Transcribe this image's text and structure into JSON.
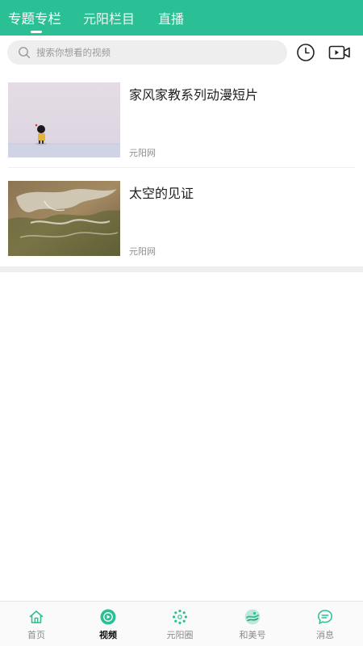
{
  "header": {
    "tabs": [
      {
        "label": "专题专栏",
        "active": true
      },
      {
        "label": "元阳栏目",
        "active": false
      },
      {
        "label": "直播",
        "active": false
      }
    ]
  },
  "search": {
    "placeholder": "搜索你想看的视频"
  },
  "actions": {
    "history_icon": "clock-icon",
    "video_icon": "video-camera-icon"
  },
  "videos": [
    {
      "title": "家风家教系列动漫短片",
      "source": "元阳网"
    },
    {
      "title": "太空的见证",
      "source": "元阳网"
    }
  ],
  "bottom_nav": [
    {
      "label": "首页",
      "icon": "home-icon",
      "active": false
    },
    {
      "label": "视频",
      "icon": "play-icon",
      "active": true
    },
    {
      "label": "元阳圈",
      "icon": "circle-dots-icon",
      "active": false
    },
    {
      "label": "和美号",
      "icon": "logo-icon",
      "active": false
    },
    {
      "label": "消息",
      "icon": "chat-icon",
      "active": false
    }
  ],
  "colors": {
    "brand": "#2bbf96",
    "nav_inactive": "#8a8a8a",
    "nav_active": "#111111"
  }
}
